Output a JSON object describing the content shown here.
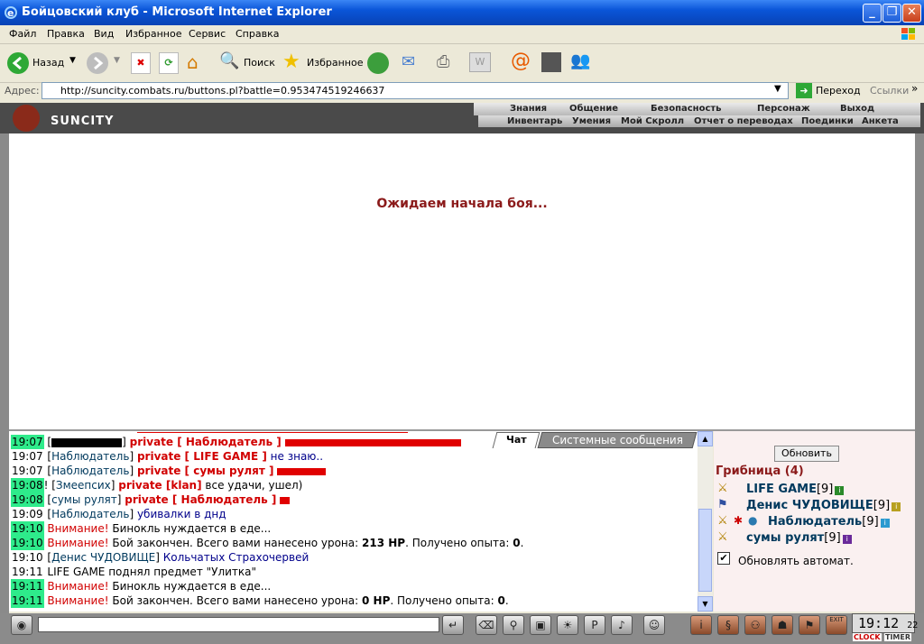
{
  "window": {
    "title": "Бойцовский клуб - Microsoft Internet Explorer"
  },
  "menu": [
    "Файл",
    "Правка",
    "Вид",
    "Избранное",
    "Сервис",
    "Справка"
  ],
  "toolbar": {
    "back": "Назад",
    "search": "Поиск",
    "favorites": "Избранное"
  },
  "address": {
    "label": "Адрес:",
    "url": "http://suncity.combats.ru/buttons.pl?battle=0.953474519246637",
    "go": "Переход",
    "links": "Ссылки"
  },
  "game": {
    "logo": "SUNCITY",
    "nav_top": [
      "Знания",
      "Общение",
      "Безопасность",
      "Персонаж",
      "Выход"
    ],
    "nav_bottom": [
      "Инвентарь",
      "Умения",
      "Мой Скролл",
      "Отчет о переводах",
      "Поединки",
      "Анкета"
    ]
  },
  "main": {
    "waiting": "Ожидаем начала боя..."
  },
  "chat_tabs": {
    "chat": "Чат",
    "system": "Системные сообщения"
  },
  "chat": {
    "lines": [
      {
        "time": "19:07",
        "hl": true,
        "pre": "[",
        "nick": "",
        "post": "]",
        "priv": "private [ Наблюдатель ]",
        "text": ""
      },
      {
        "time": "19:07",
        "hl": false,
        "pre": "[",
        "nick": "Наблюдатель",
        "post": "]",
        "priv": "private [ LIFE GAME ]",
        "text": "не знаю.."
      },
      {
        "time": "19:07",
        "hl": false,
        "pre": "[",
        "nick": "Наблюдатель",
        "post": "]",
        "priv": "private [ сумы рулят ]",
        "text": ""
      },
      {
        "time": "19:08",
        "hl": true,
        "pre": "! [",
        "nick": "Змеепсих",
        "post": "]",
        "priv": "private [klan]",
        "text": "все удачи, ушел)"
      },
      {
        "time": "19:08",
        "hl": true,
        "pre": "[",
        "nick": "сумы рулят",
        "post": "]",
        "priv": "private [ Наблюдатель ]",
        "text": ""
      },
      {
        "time": "19:09",
        "hl": false,
        "pre": "[",
        "nick": "Наблюдатель",
        "post": "]",
        "priv": "",
        "text": "убивалки в днд"
      },
      {
        "time": "19:10",
        "hl": true,
        "warn": "Внимание!",
        "text": "Бинокль нуждается в еде..."
      },
      {
        "time": "19:10",
        "hl": true,
        "warn": "Внимание!",
        "text": "Бой закончен. Всего вами нанесено урона:",
        "b1": "213 HP",
        "text2": ". Получено опыта:",
        "b2": "0",
        "text3": "."
      },
      {
        "time": "19:10",
        "hl": false,
        "pre": "[",
        "nick": "Денис ЧУДОВИЩЕ",
        "post": "]",
        "priv": "",
        "text": "Кольчатых Страхочервей"
      },
      {
        "time": "19:11",
        "hl": false,
        "plain": "LIFE GAME поднял предмет \"Улитка\""
      },
      {
        "time": "19:11",
        "hl": true,
        "warn": "Внимание!",
        "text": "Бинокль нуждается в еде..."
      },
      {
        "time": "19:11",
        "hl": true,
        "warn": "Внимание!",
        "text": "Бой закончен. Всего вами нанесено урона:",
        "b1": "0 HP",
        "text2": ". Получено опыта:",
        "b2": "0",
        "text3": "."
      }
    ]
  },
  "panel": {
    "refresh": "Обновить",
    "room": "Грибница (4)",
    "users": [
      {
        "name": "LIFE GAME",
        "level": "[9]"
      },
      {
        "name": "Денис ЧУДОВИЩЕ",
        "level": "[9]"
      },
      {
        "name": "Наблюдатель",
        "level": "[9]"
      },
      {
        "name": "сумы рулят",
        "level": "[9]"
      }
    ],
    "auto": "Обновлять автомат."
  },
  "clock": {
    "time": "19:12",
    "sec": "22",
    "clock_label": "CLOCK",
    "timer_label": "TIMER",
    "exit": "EXIT"
  }
}
